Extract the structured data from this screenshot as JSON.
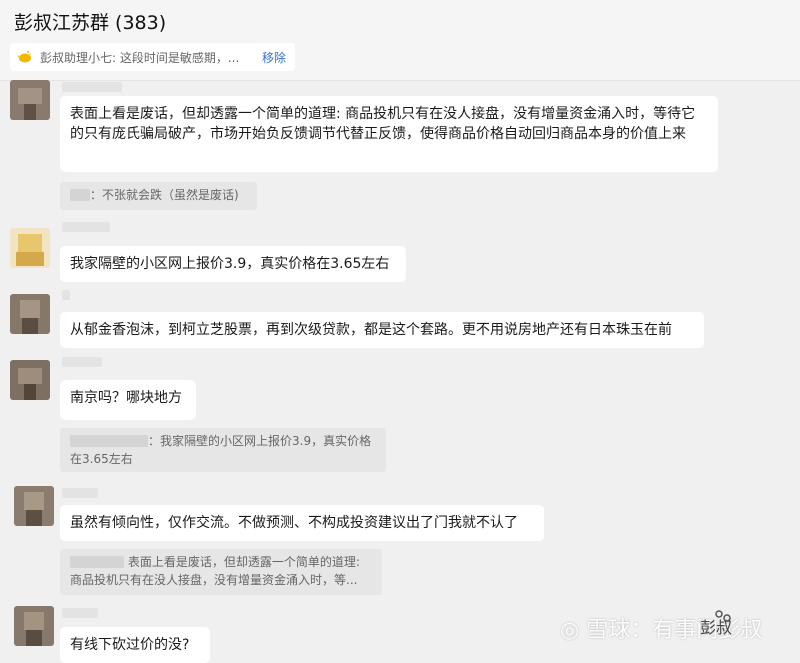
{
  "chat": {
    "title": "彭叔江苏群 (383)",
    "pinned": {
      "text": "彭叔助理小七: 这段时间是敏感期，...",
      "remove_label": "移除"
    }
  },
  "messages": [
    {
      "text": "表面上看是废话，但却透露一个简单的道理: 商品投机只有在没人接盘，没有增量资金涌入时，等待它的只有庞氏骗局破产，市场开始负反馈调节代替正反馈，使得商品价格自动回归商品本身的价值上来"
    },
    {
      "text": "我家隔壁的小区网上报价3.9，真实价格在3.65左右"
    },
    {
      "text": "从郁金香泡沫，到柯立芝股票，再到次级贷款，都是这个套路。更不用说房地产还有日本珠玉在前"
    },
    {
      "text": "南京吗？哪块地方"
    },
    {
      "text": "虽然有倾向性，仅作交流。不做预测、不构成投资建议出了门我就不认了"
    },
    {
      "text": "有线下砍过价的没?"
    }
  ],
  "quotes": [
    {
      "line1": "：不张就会跌（虽然是废话)"
    },
    {
      "line1": "：我家隔壁的小区网上报价3.9，真实价格",
      "line2": "在3.65左右"
    },
    {
      "line1": "表面上看是废话，但却透露一个简单的道理:",
      "line2": "商品投机只有在没人接盘，没有增量资金涌入时，等..."
    }
  ],
  "watermark": {
    "text": "◎ 雪球：有事问彭叔",
    "account": "彭叔"
  },
  "colors": {
    "background": "#f0f0f0",
    "bubble": "#ffffff",
    "quote": "#e6e6e6",
    "link": "#3a73c4"
  }
}
